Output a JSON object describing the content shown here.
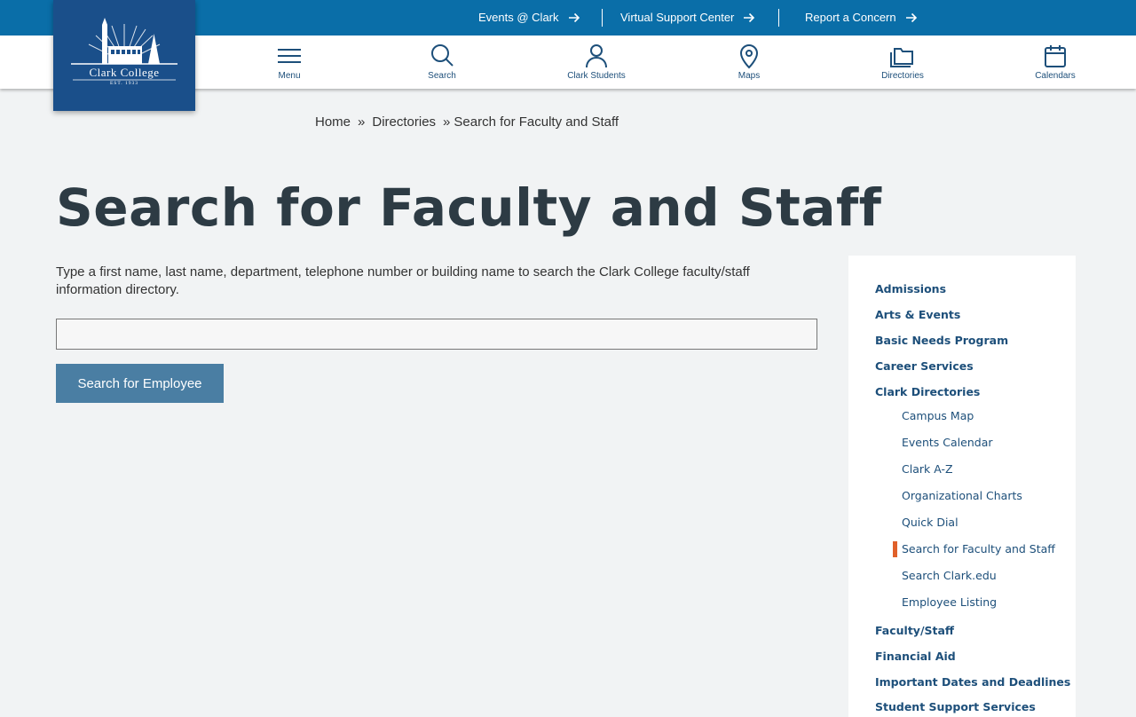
{
  "top_links": [
    {
      "label": "Events @ Clark"
    },
    {
      "label": "Virtual Support Center"
    },
    {
      "label": "Report a Concern"
    }
  ],
  "logo": {
    "name": "Clark College",
    "est": "EST. 1933"
  },
  "nav_icons": [
    {
      "label": "Menu",
      "icon": "menu-icon"
    },
    {
      "label": "Search",
      "icon": "search-icon"
    },
    {
      "label": "Clark Students",
      "icon": "user-icon"
    },
    {
      "label": "Maps",
      "icon": "map-pin-icon"
    },
    {
      "label": "Directories",
      "icon": "folder-icon"
    },
    {
      "label": "Calendars",
      "icon": "calendar-icon"
    }
  ],
  "breadcrumb": {
    "items": [
      "Home",
      "Directories",
      "Search for Faculty and Staff"
    ],
    "separator": "»"
  },
  "main": {
    "title": "Search for Faculty and Staff",
    "intro": "Type a first name, last name, department, telephone number or building name to search the Clark College faculty/staff information directory.",
    "search_value": "",
    "search_placeholder": "",
    "button_label": "Search for Employee"
  },
  "sidenav": {
    "sections_top": [
      "Admissions",
      "Arts & Events",
      "Basic Needs Program",
      "Career Services",
      "Clark Directories"
    ],
    "sub_items": [
      "Campus Map",
      "Events Calendar",
      "Clark A-Z",
      "Organizational Charts",
      "Quick Dial",
      "Search for Faculty and Staff",
      "Search Clark.edu",
      "Employee Listing"
    ],
    "current": "Search for Faculty and Staff",
    "sections_bottom": [
      "Faculty/Staff",
      "Financial Aid",
      "Important Dates and Deadlines",
      "Student Support Services"
    ]
  },
  "colors": {
    "top_bar": "#0a6ea8",
    "logo_bg": "#1a4f8a",
    "nav_text": "#1d4f7a",
    "button_bg": "#4a7ea3",
    "current_marker": "#e0602a",
    "page_bg": "#f1f3f4"
  }
}
